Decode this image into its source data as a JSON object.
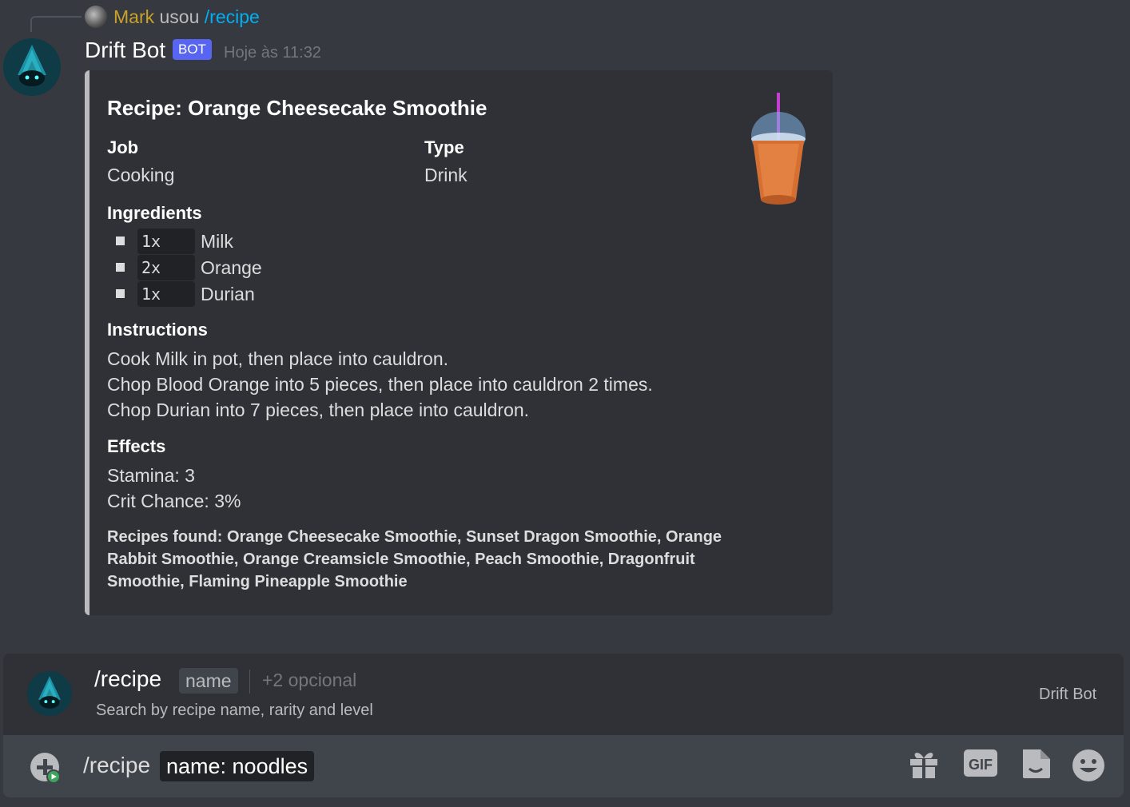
{
  "reply": {
    "user": "Mark",
    "used_text": "usou",
    "command": "/recipe"
  },
  "message": {
    "author": "Drift Bot",
    "badge": "BOT",
    "timestamp": "Hoje às 11:32"
  },
  "embed": {
    "title": "Recipe: Orange Cheesecake Smoothie",
    "fields": [
      {
        "name": "Job",
        "value": "Cooking"
      },
      {
        "name": "Type",
        "value": "Drink"
      }
    ],
    "ingredients_heading": "Ingredients",
    "ingredients": [
      {
        "qty": "1x",
        "name": "Milk"
      },
      {
        "qty": "2x",
        "name": "Orange"
      },
      {
        "qty": "1x",
        "name": "Durian"
      }
    ],
    "instructions_heading": "Instructions",
    "instructions": [
      "Cook Milk in pot, then place into cauldron.",
      "Chop Blood Orange into 5 pieces, then place into cauldron 2 times.",
      "Chop Durian into 7 pieces, then place into cauldron."
    ],
    "effects_heading": "Effects",
    "effects": [
      "Stamina: 3",
      "Crit Chance: 3%"
    ],
    "footer": "Recipes found: Orange Cheesecake Smoothie, Sunset Dragon Smoothie, Orange Rabbit Smoothie, Orange Creamsicle Smoothie, Peach Smoothie, Dragonfruit Smoothie, Flaming Pineapple Smoothie",
    "thumbnail_icon": "smoothie-cup-icon",
    "accent_color": "#b9bbbe"
  },
  "autocomplete": {
    "command": "/recipe",
    "param": "name",
    "optional": "+2 opcional",
    "description": "Search by recipe name, rarity and level",
    "source": "Drift Bot"
  },
  "input": {
    "command": "/recipe",
    "chip": "name: noodles"
  },
  "toolbar": {
    "icons": [
      "gift-icon",
      "gif-icon",
      "sticker-icon",
      "emoji-icon"
    ],
    "gif_label": "GIF"
  },
  "colors": {
    "background": "#36393f",
    "embed_bg": "#2f3136",
    "bot_badge": "#5865f2",
    "username": "#c9a227",
    "command_link": "#00aff4",
    "input_bg": "#40444b"
  }
}
